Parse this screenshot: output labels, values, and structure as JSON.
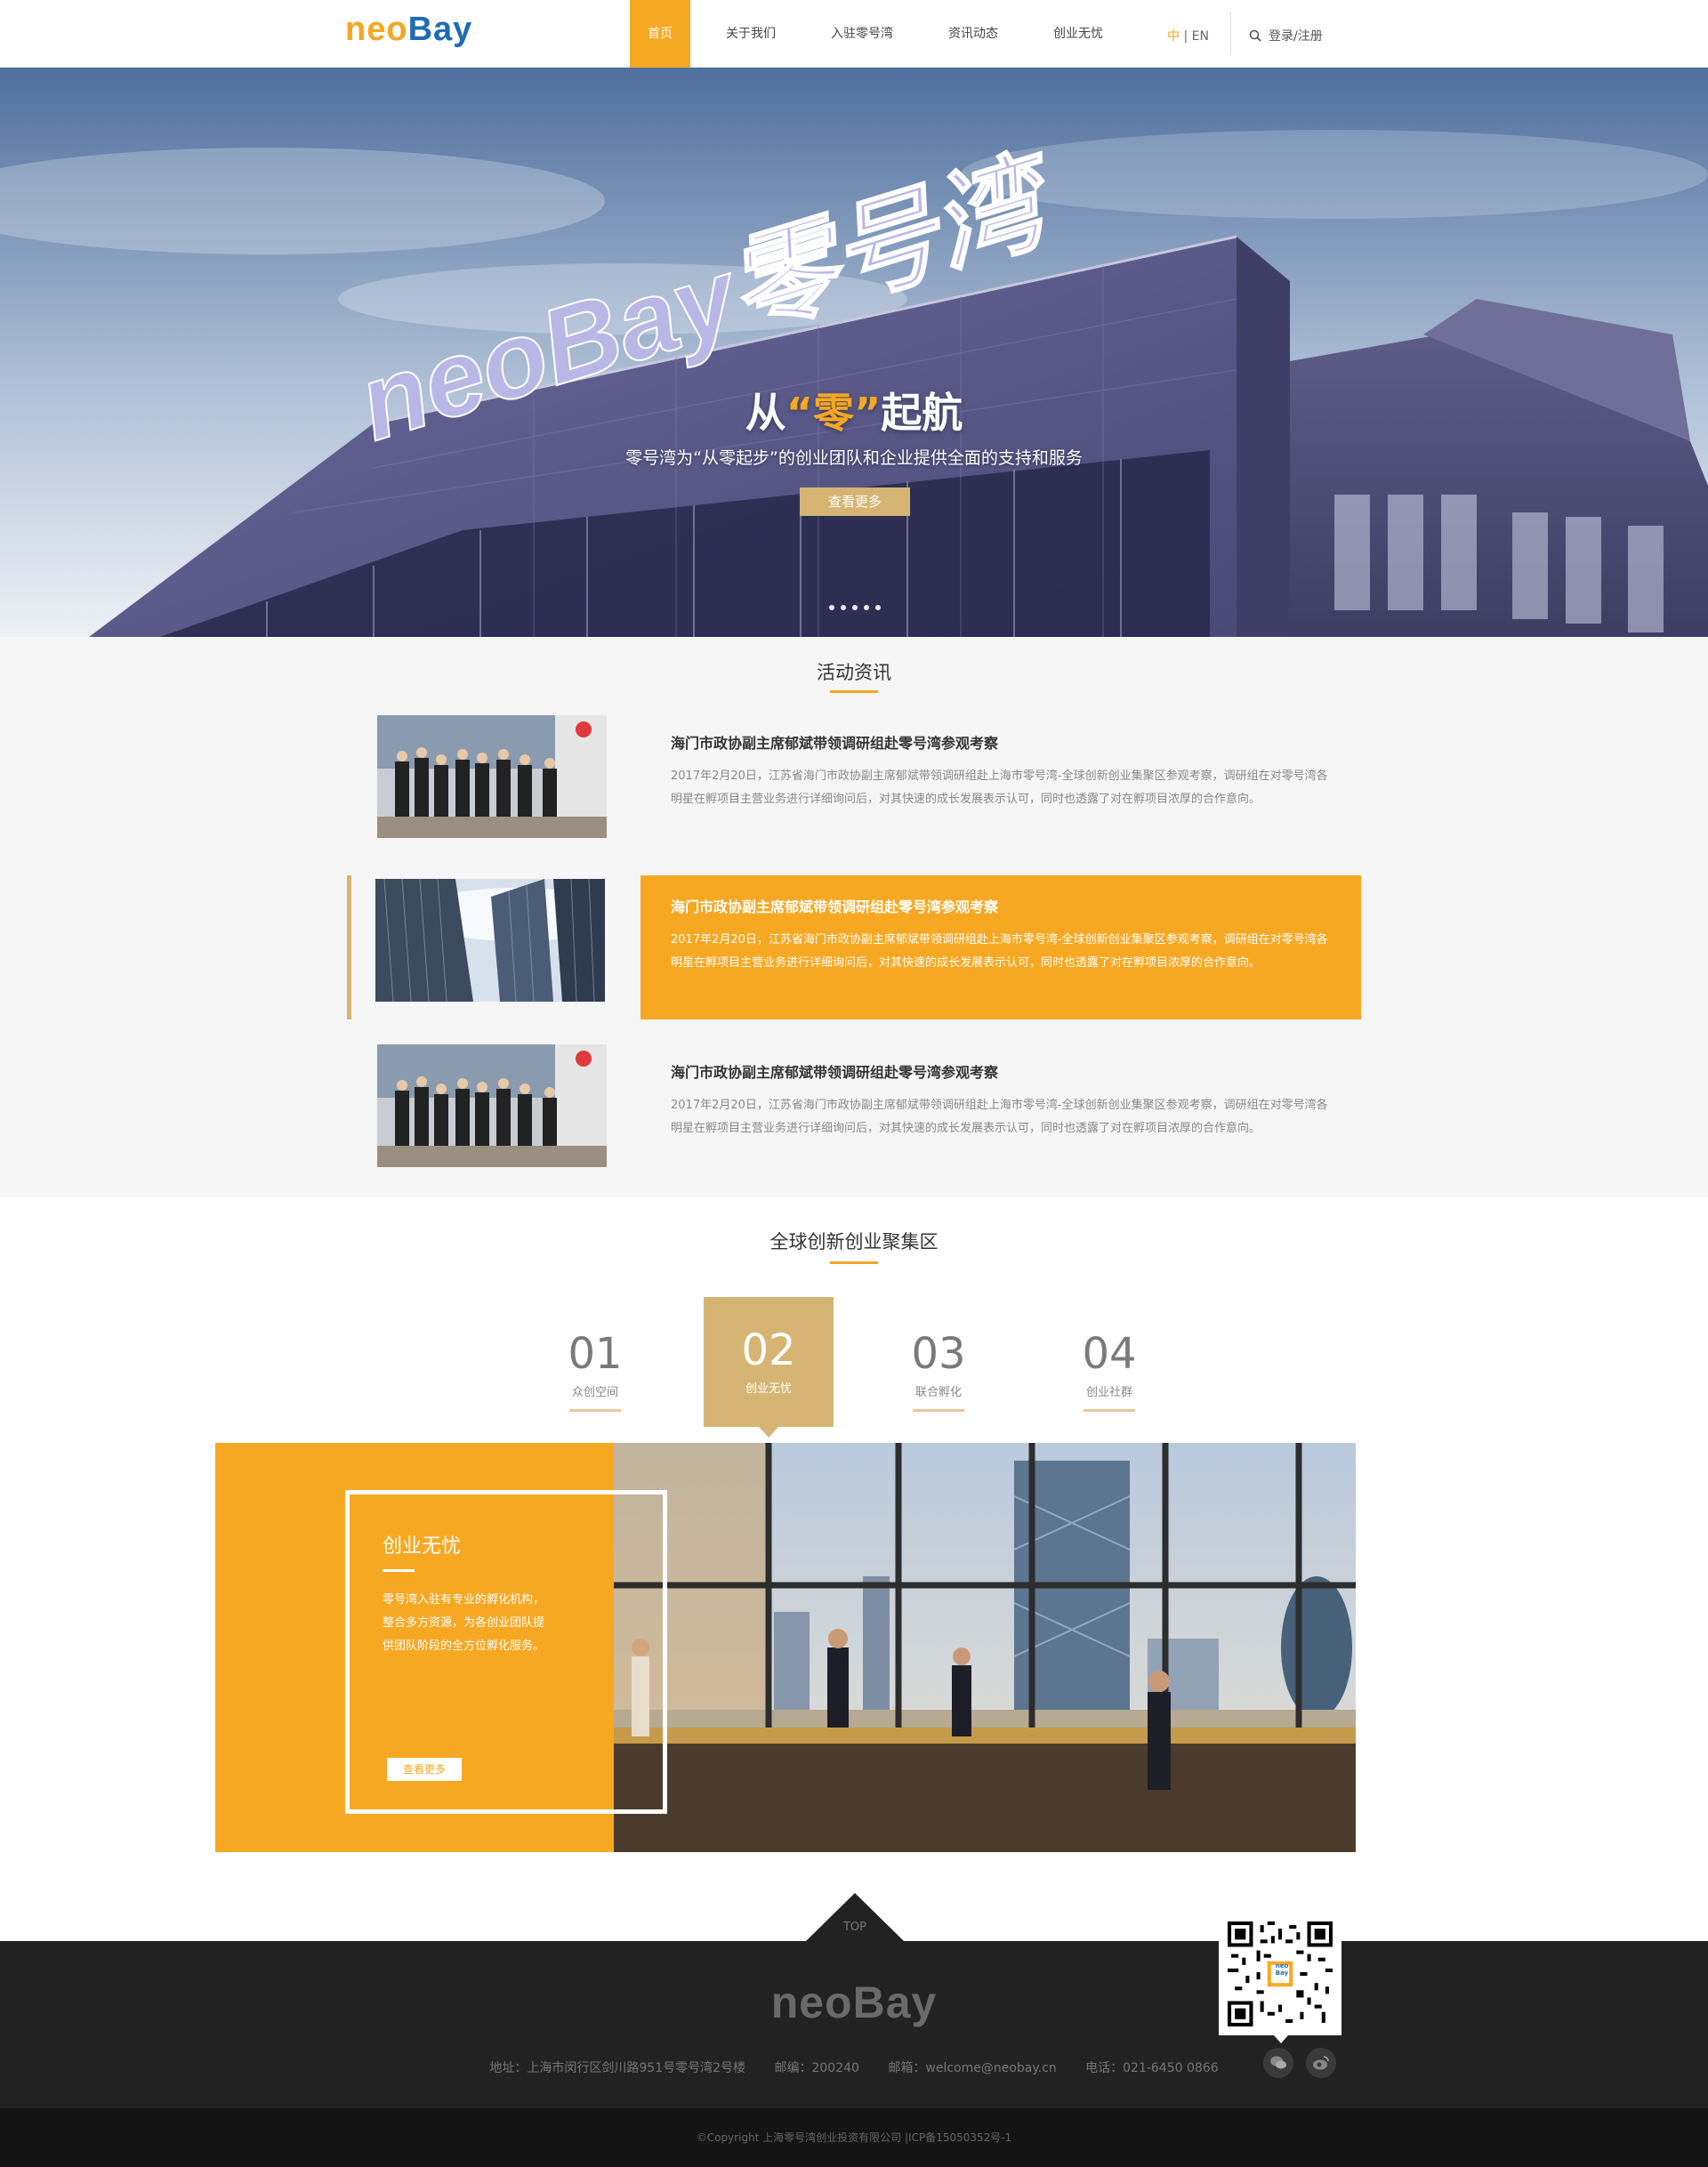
{
  "header": {
    "logo_part1": "neo",
    "logo_part2": "Bay",
    "nav": [
      {
        "label": "首页",
        "active": true
      },
      {
        "label": "关于我们"
      },
      {
        "label": "入驻零号湾"
      },
      {
        "label": "资讯动态"
      },
      {
        "label": "创业无忧"
      }
    ],
    "lang_zh": "中",
    "lang_sep": " | ",
    "lang_en": "EN",
    "search_icon": "search-icon",
    "login": "登录/注册"
  },
  "hero": {
    "sign_text": "neoBay零号湾",
    "title_pre": "从",
    "title_hl": "“零”",
    "title_post": "起航",
    "subtitle": "零号湾为“从零起步”的创业团队和企业提供全面的支持和服务",
    "button": "查看更多",
    "slide_count": 5
  },
  "news": {
    "title": "活动资讯",
    "items": [
      {
        "title": "海门市政协副主席郁斌带领调研组赴零号湾参观考察",
        "body": "2017年2月20日，江苏省海门市政协副主席郁斌带领调研组赴上海市零号湾-全球创新创业集聚区参观考察，调研组在对零号湾各明星在孵项目主营业务进行详细询问后，对其快速的成长发展表示认可，同时也透露了对在孵项目浓厚的合作意向。"
      },
      {
        "title": "海门市政协副主席郁斌带领调研组赴零号湾参观考察",
        "body": "2017年2月20日，江苏省海门市政协副主席郁斌带领调研组赴上海市零号湾-全球创新创业集聚区参观考察，调研组在对零号湾各明星在孵项目主营业务进行详细询问后，对其快速的成长发展表示认可，同时也透露了对在孵项目浓厚的合作意向。"
      },
      {
        "title": "海门市政协副主席郁斌带领调研组赴零号湾参观考察",
        "body": "2017年2月20日，江苏省海门市政协副主席郁斌带领调研组赴上海市零号湾-全球创新创业集聚区参观考察，调研组在对零号湾各明星在孵项目主营业务进行详细询问后，对其快速的成长发展表示认可，同时也透露了对在孵项目浓厚的合作意向。"
      }
    ]
  },
  "zone": {
    "title": "全球创新创业聚集区",
    "tabs": [
      {
        "num": "01",
        "label": "众创空间"
      },
      {
        "num": "02",
        "label": "创业无忧",
        "active": true
      },
      {
        "num": "03",
        "label": "联合孵化"
      },
      {
        "num": "04",
        "label": "创业社群"
      }
    ],
    "feature_title": "创业无忧",
    "feature_body": "零号湾入驻有专业的孵化机构，整合多方资源，为各创业团队提供团队阶段的全方位孵化服务。",
    "feature_button": "查看更多"
  },
  "footer": {
    "top": "TOP",
    "logo": "neoBay",
    "address": "地址：上海市闵行区剑川路951号零号湾2号楼",
    "postcode": "邮编：200240",
    "email": "邮箱：welcome@neobay.cn",
    "phone": "电话：021-6450 0866",
    "qr_badge": "neo Bay",
    "social": [
      "wechat-icon",
      "weibo-icon"
    ],
    "copyright": "©Copyright 上海零号湾创业投资有限公司 |ICP备15050352号-1"
  },
  "colors": {
    "accent": "#f7a823",
    "gold": "#d6b574",
    "logo_blue": "#1f6cb4",
    "footer": "#222222"
  }
}
